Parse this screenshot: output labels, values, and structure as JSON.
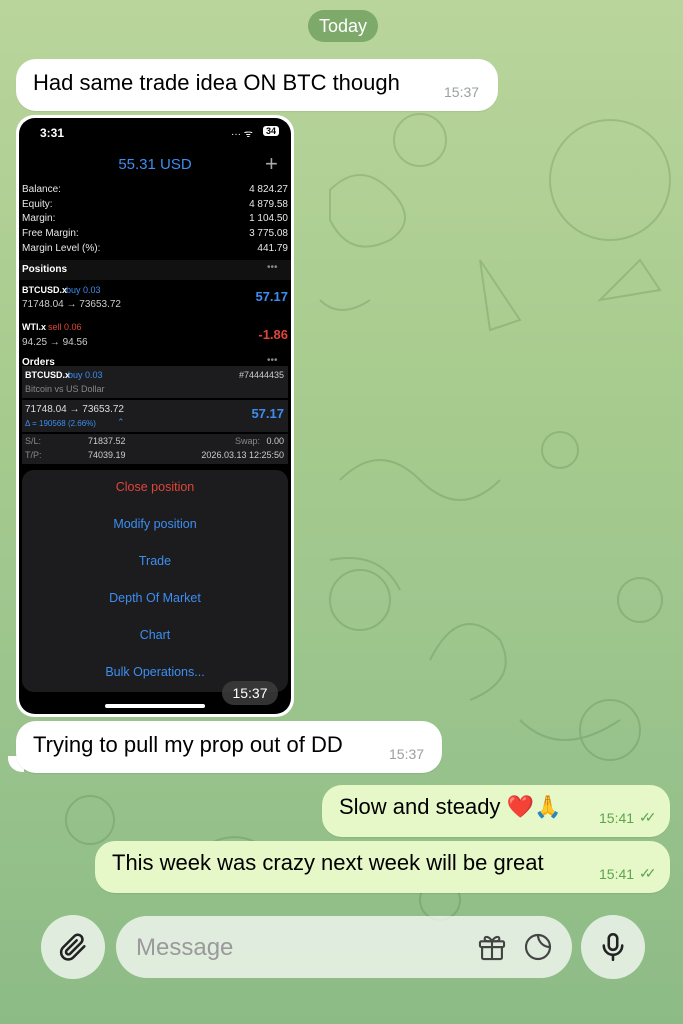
{
  "day_separator": "Today",
  "messages": [
    {
      "text": "Had same trade idea ON BTC though",
      "time": "15:37"
    },
    {
      "image_time": "15:37"
    },
    {
      "text": "Trying to pull my prop out of DD",
      "time": "15:37"
    },
    {
      "text": "Slow and steady ❤️🙏",
      "time": "15:41"
    },
    {
      "text": "This week was crazy next week will be great",
      "time": "15:41"
    }
  ],
  "screenshot": {
    "status_time": "3:31",
    "battery": "34",
    "header_profit": "55.31 USD",
    "account": [
      {
        "label": "Balance:",
        "value": "4 824.27"
      },
      {
        "label": "Equity:",
        "value": "4 879.58"
      },
      {
        "label": "Margin:",
        "value": "1 104.50"
      },
      {
        "label": "Free Margin:",
        "value": "3 775.08"
      },
      {
        "label": "Margin Level (%):",
        "value": "441.79"
      }
    ],
    "positions_title": "Positions",
    "positions": [
      {
        "symbol": "BTCUSD.x",
        "side": "buy 0.03",
        "prices": "71748.04 → 73653.72",
        "profit": "57.17"
      },
      {
        "symbol": "WTI.x",
        "side": "sell 0.06",
        "prices": "94.25 → 94.56",
        "profit": "-1.86"
      }
    ],
    "orders_title": "Orders",
    "detail": {
      "symbol": "BTCUSD.x",
      "side": "buy 0.03",
      "ticket": "#74444435",
      "description": "Bitcoin vs US Dollar",
      "prices": "71748.04 → 73653.72",
      "profit": "57.17",
      "delta": "Δ = 190568 (2.66%)",
      "sl_label": "S/L:",
      "sl": "71837.52",
      "swap_label": "Swap:",
      "swap": "0.00",
      "tp_label": "T/P:",
      "tp": "74039.19",
      "date": "2026.03.13 12:25:50"
    },
    "menu": [
      "Close position",
      "Modify position",
      "Trade",
      "Depth Of Market",
      "Chart",
      "Bulk Operations..."
    ]
  },
  "composer": {
    "placeholder": "Message"
  },
  "colors": {
    "accent_blue": "#3d8ef0",
    "loss_red": "#e0453a",
    "outgoing_bubble": "#e7f8c8",
    "time_green": "#5aa550"
  }
}
